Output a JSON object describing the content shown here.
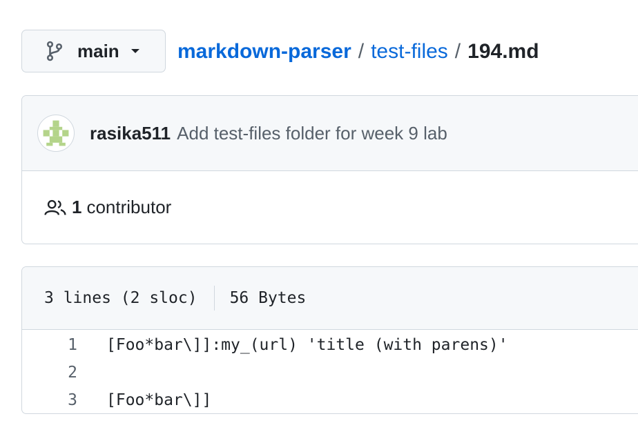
{
  "branch": {
    "label": "main",
    "icon": "git-branch-icon"
  },
  "breadcrumb": {
    "repo": "markdown-parser",
    "folder": "test-files",
    "file": "194.md",
    "separator": "/"
  },
  "commit": {
    "author": "rasika511",
    "message": "Add test-files folder for week 9 lab"
  },
  "contributors": {
    "count": "1",
    "label": "contributor"
  },
  "file_info": {
    "lines": "3 lines (2 sloc)",
    "size": "56 Bytes"
  },
  "code_lines": [
    {
      "num": "1",
      "text": "[Foo*bar\\]]:my_(url) 'title (with parens)'"
    },
    {
      "num": "2",
      "text": ""
    },
    {
      "num": "3",
      "text": "[Foo*bar\\]]"
    }
  ],
  "colors": {
    "link": "#0969da",
    "muted": "#57606a",
    "header_bg": "#f6f8fa",
    "border": "#d0d7de"
  }
}
